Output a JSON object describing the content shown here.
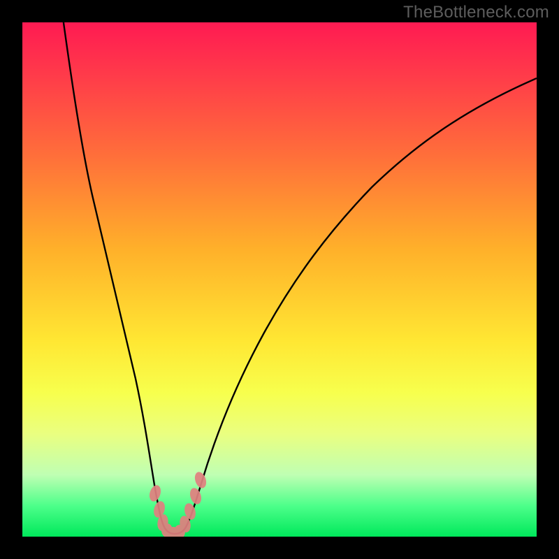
{
  "watermark": "TheBottleneck.com",
  "chart_data": {
    "type": "line",
    "title": "",
    "xlabel": "",
    "ylabel": "",
    "xlim": [
      0,
      100
    ],
    "ylim": [
      0,
      100
    ],
    "background_gradient": {
      "top": "#ff1a52",
      "upper_mid": "#ffb02a",
      "mid": "#ffe733",
      "lower_mid": "#eaff80",
      "bottom": "#00e85b",
      "meaning": "red=high bottleneck, green=low bottleneck"
    },
    "series": [
      {
        "name": "bottleneck-curve",
        "color": "#000000",
        "x": [
          8,
          10,
          13,
          16,
          19,
          22,
          24,
          25.5,
          27,
          28.5,
          30,
          31.5,
          33.5,
          35,
          38,
          42,
          47,
          53,
          60,
          68,
          77,
          88,
          100
        ],
        "y_percent": [
          100,
          87,
          71,
          56,
          42,
          27,
          14,
          6,
          1.5,
          0.5,
          0.5,
          1.5,
          6,
          12,
          23,
          36,
          48,
          58,
          67,
          75,
          81,
          86,
          89
        ]
      }
    ],
    "highlight": {
      "name": "optimal-range",
      "color": "#e18080",
      "x_range": [
        25.5,
        33.5
      ],
      "points_xy": [
        [
          25.5,
          6
        ],
        [
          26.3,
          3
        ],
        [
          27.2,
          1.5
        ],
        [
          28.2,
          0.5
        ],
        [
          29.3,
          0.5
        ],
        [
          30.4,
          0.5
        ],
        [
          31.4,
          1.5
        ],
        [
          32.3,
          3
        ],
        [
          33.3,
          6
        ],
        [
          34.0,
          9
        ]
      ]
    }
  }
}
